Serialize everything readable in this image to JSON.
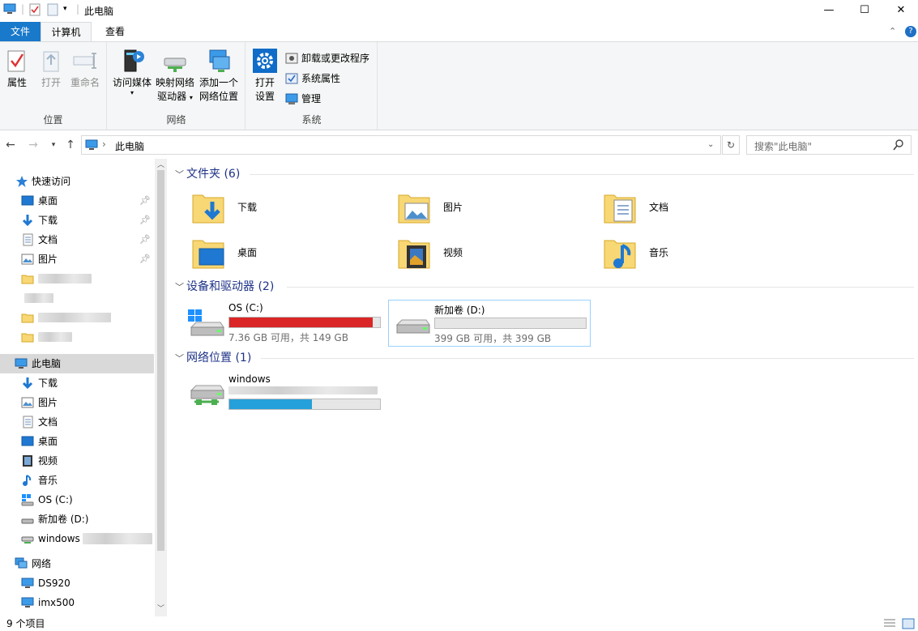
{
  "window": {
    "title": "此电脑",
    "controls": {
      "minimize": "—",
      "maximize": "☐",
      "close": "✕"
    }
  },
  "ribbon": {
    "tabs": [
      {
        "label": "文件"
      },
      {
        "label": "计算机"
      },
      {
        "label": "查看"
      }
    ],
    "groups": [
      {
        "label": "位置",
        "buttons": [
          "属性",
          "打开",
          "重命名"
        ]
      },
      {
        "label": "网络",
        "buttons": [
          "访问媒体",
          "映射网络",
          "驱动器",
          "添加一个",
          "网络位置"
        ]
      },
      {
        "label": "系统",
        "buttons": [
          "打开",
          "设置"
        ],
        "small": [
          "卸载或更改程序",
          "系统属性",
          "管理"
        ]
      }
    ]
  },
  "address": {
    "path": "此电脑",
    "search_placeholder": "搜索\"此电脑\""
  },
  "sidebar": {
    "quick_access": "快速访问",
    "quick_items": [
      "桌面",
      "下载",
      "文档",
      "图片"
    ],
    "this_pc": "此电脑",
    "pc_items": [
      "下载",
      "图片",
      "文档",
      "桌面",
      "视频",
      "音乐",
      "OS (C:)",
      "新加卷 (D:)",
      "windows"
    ],
    "network": "网络",
    "network_items": [
      "DS920",
      "imx500"
    ]
  },
  "main": {
    "folders_header": "文件夹 (6)",
    "folders": [
      "下载",
      "图片",
      "文档",
      "桌面",
      "视频",
      "音乐"
    ],
    "devices_header": "设备和驱动器 (2)",
    "drives": [
      {
        "name": "OS (C:)",
        "info": "7.36 GB 可用，共 149 GB",
        "used_fraction": 0.951,
        "bar_color": "#da2626"
      },
      {
        "name": "新加卷 (D:)",
        "info": "399 GB 可用，共 399 GB",
        "used_fraction": 0.0,
        "bar_color": "#26a0da"
      }
    ],
    "network_header": "网络位置 (1)",
    "network_locations": [
      {
        "name": "windows",
        "used_fraction": 0.55,
        "bar_color": "#26a0da"
      }
    ]
  },
  "status": {
    "count": "9 个项目"
  }
}
